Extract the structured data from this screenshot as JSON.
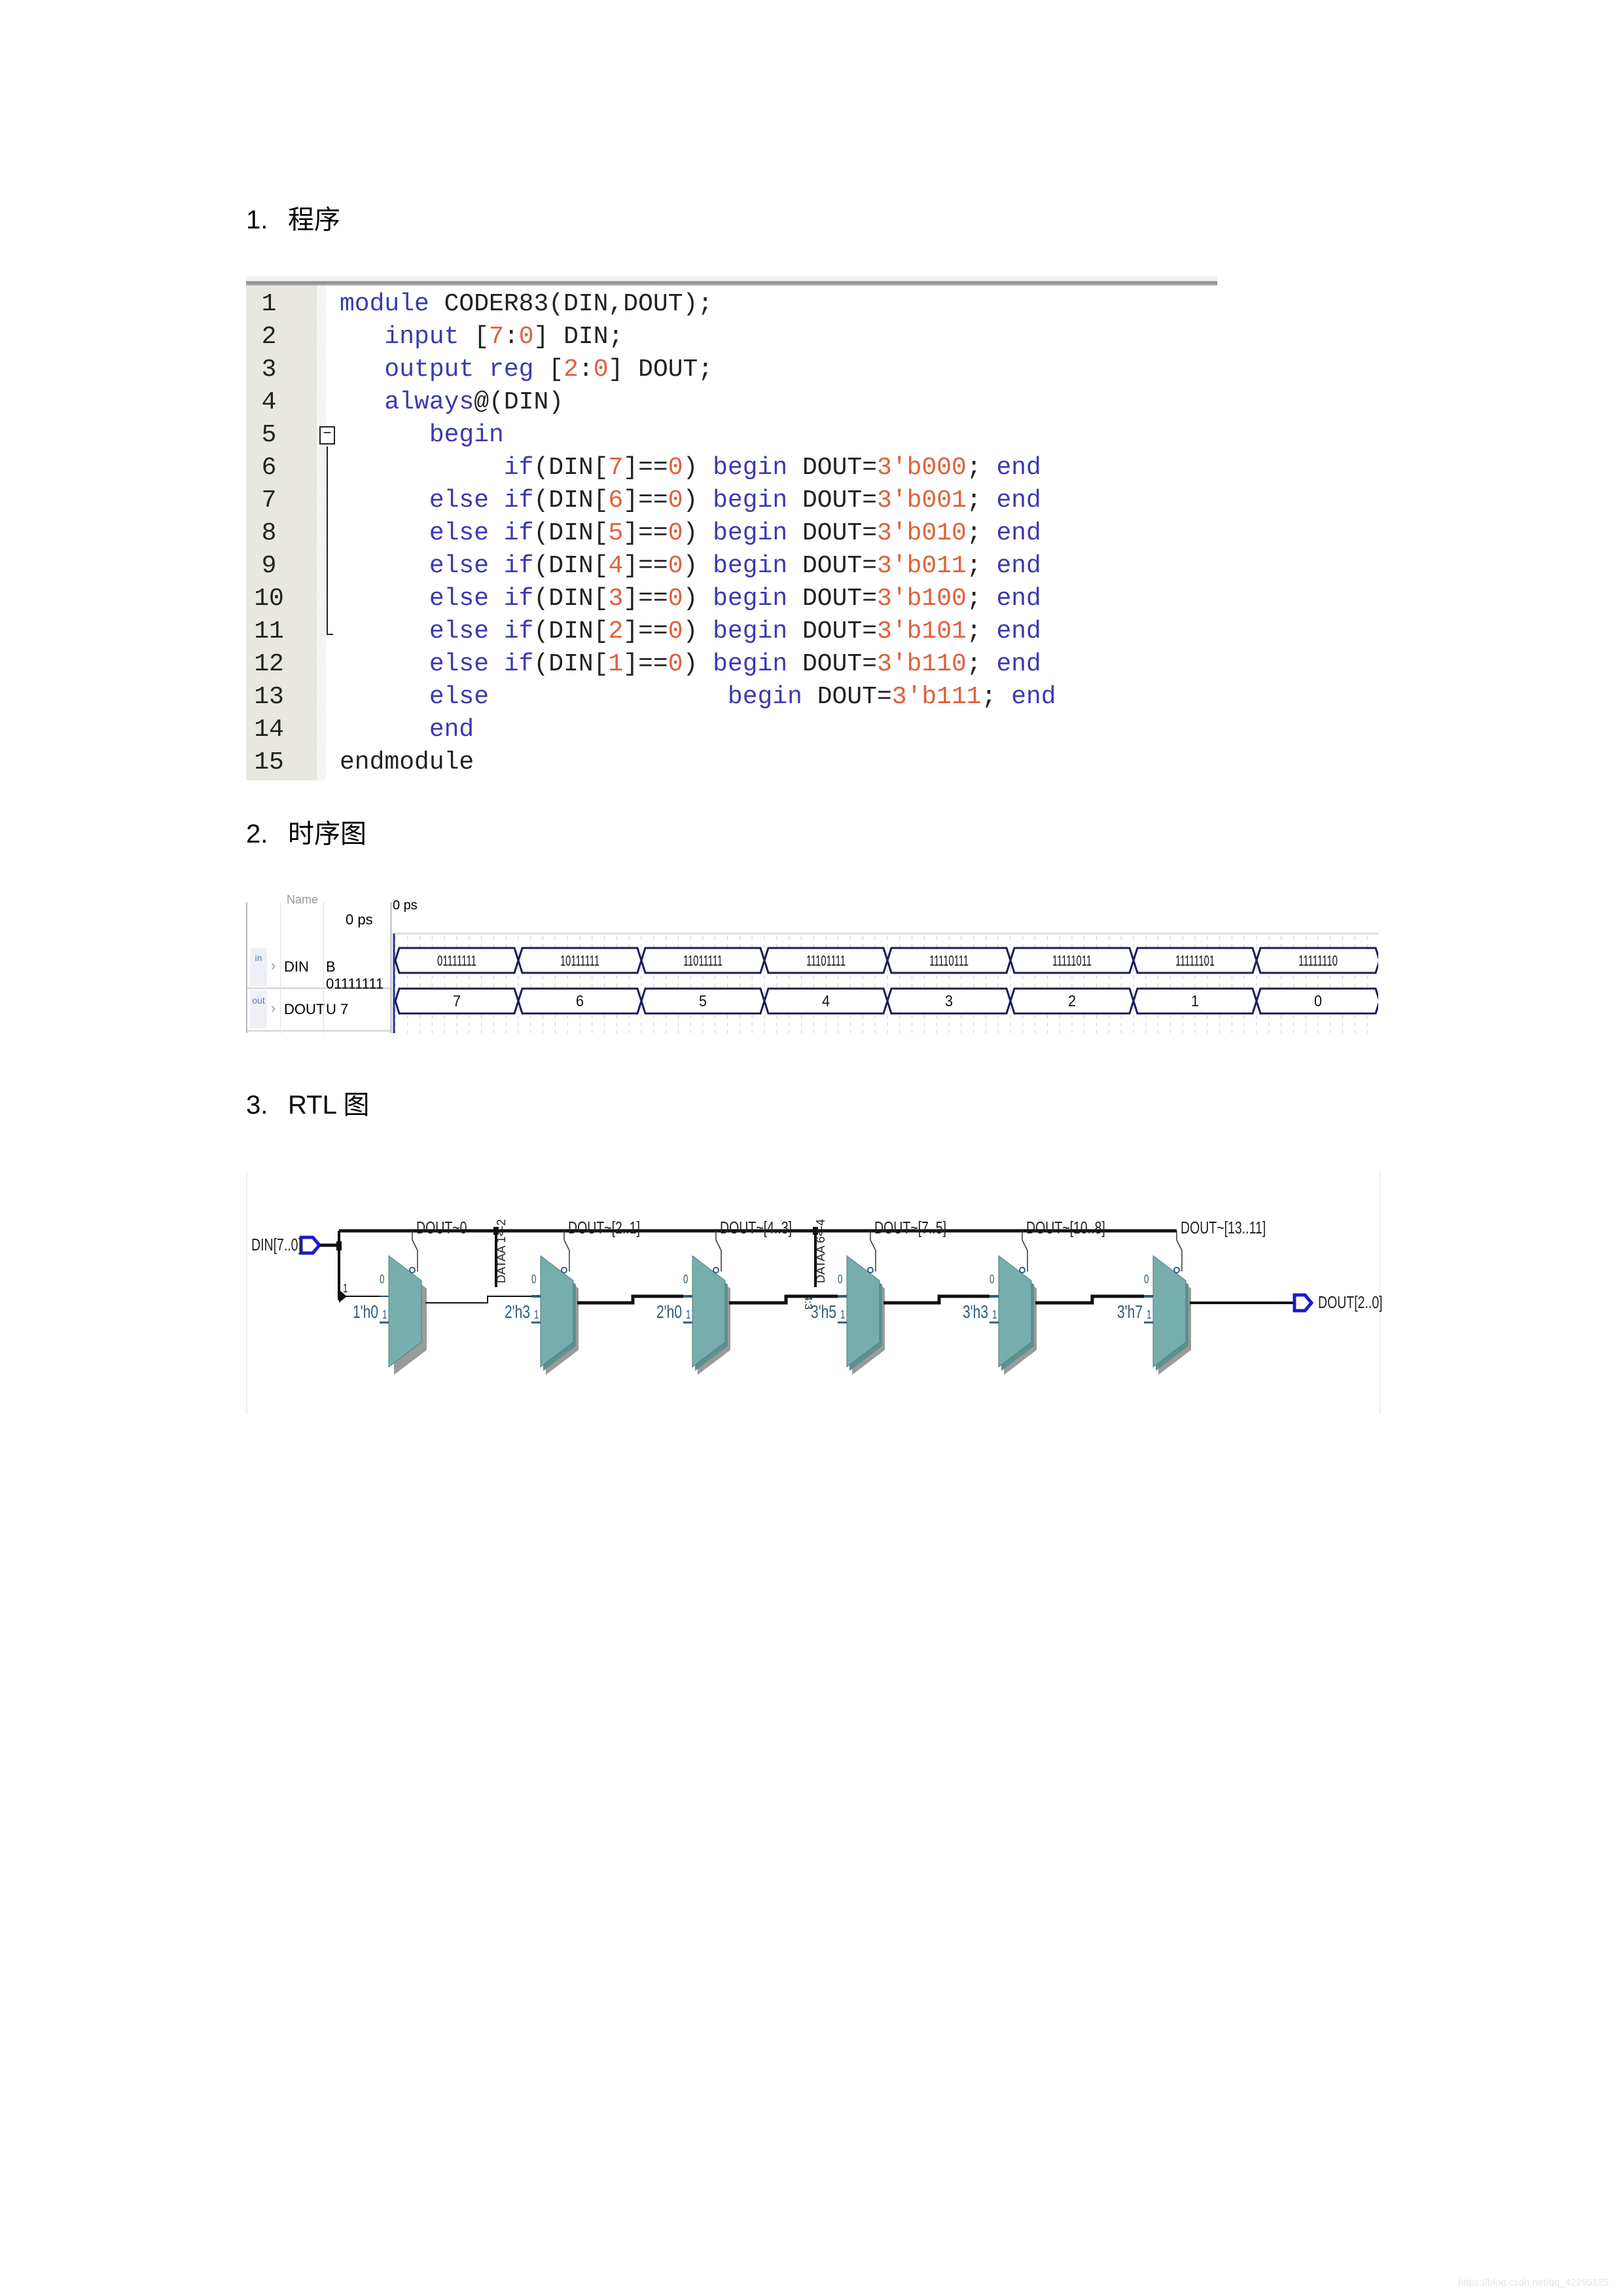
{
  "sections": [
    {
      "number": "1.",
      "title": "程序"
    },
    {
      "number": "2.",
      "title": "时序图"
    },
    {
      "number": "3.",
      "title": "RTL 图"
    }
  ],
  "code": {
    "lines": [
      {
        "n": "1",
        "tokens": [
          [
            "kw",
            "module"
          ],
          [
            "tx",
            " CODER83(DIN,DOUT);"
          ]
        ]
      },
      {
        "n": "2",
        "tokens": [
          [
            "tx",
            "   "
          ],
          [
            "kw",
            "input"
          ],
          [
            "tx",
            " ["
          ],
          [
            "nm",
            "7"
          ],
          [
            "tx",
            ":"
          ],
          [
            "nm",
            "0"
          ],
          [
            "tx",
            "] DIN;"
          ]
        ]
      },
      {
        "n": "3",
        "tokens": [
          [
            "tx",
            "   "
          ],
          [
            "kw",
            "output"
          ],
          [
            "tx",
            " "
          ],
          [
            "kw",
            "reg"
          ],
          [
            "tx",
            " ["
          ],
          [
            "nm",
            "2"
          ],
          [
            "tx",
            ":"
          ],
          [
            "nm",
            "0"
          ],
          [
            "tx",
            "] DOUT;"
          ]
        ]
      },
      {
        "n": "4",
        "tokens": [
          [
            "tx",
            "   "
          ],
          [
            "kw",
            "always"
          ],
          [
            "tx",
            "@(DIN)"
          ]
        ]
      },
      {
        "n": "5",
        "tokens": [
          [
            "tx",
            "      "
          ],
          [
            "kw",
            "begin"
          ]
        ]
      },
      {
        "n": "6",
        "tokens": [
          [
            "tx",
            "           "
          ],
          [
            "kw",
            "if"
          ],
          [
            "tx",
            "(DIN["
          ],
          [
            "nm",
            "7"
          ],
          [
            "tx",
            "]=="
          ],
          [
            "nm",
            "0"
          ],
          [
            "tx",
            ") "
          ],
          [
            "kw",
            "begin"
          ],
          [
            "tx",
            " DOUT="
          ],
          [
            "nm",
            "3'b000"
          ],
          [
            "tx",
            "; "
          ],
          [
            "kw",
            "end"
          ]
        ]
      },
      {
        "n": "7",
        "tokens": [
          [
            "tx",
            "      "
          ],
          [
            "kw",
            "else if"
          ],
          [
            "tx",
            "(DIN["
          ],
          [
            "nm",
            "6"
          ],
          [
            "tx",
            "]=="
          ],
          [
            "nm",
            "0"
          ],
          [
            "tx",
            ") "
          ],
          [
            "kw",
            "begin"
          ],
          [
            "tx",
            " DOUT="
          ],
          [
            "nm",
            "3'b001"
          ],
          [
            "tx",
            "; "
          ],
          [
            "kw",
            "end"
          ]
        ]
      },
      {
        "n": "8",
        "tokens": [
          [
            "tx",
            "      "
          ],
          [
            "kw",
            "else if"
          ],
          [
            "tx",
            "(DIN["
          ],
          [
            "nm",
            "5"
          ],
          [
            "tx",
            "]=="
          ],
          [
            "nm",
            "0"
          ],
          [
            "tx",
            ") "
          ],
          [
            "kw",
            "begin"
          ],
          [
            "tx",
            " DOUT="
          ],
          [
            "nm",
            "3'b010"
          ],
          [
            "tx",
            "; "
          ],
          [
            "kw",
            "end"
          ]
        ]
      },
      {
        "n": "9",
        "tokens": [
          [
            "tx",
            "      "
          ],
          [
            "kw",
            "else if"
          ],
          [
            "tx",
            "(DIN["
          ],
          [
            "nm",
            "4"
          ],
          [
            "tx",
            "]=="
          ],
          [
            "nm",
            "0"
          ],
          [
            "tx",
            ") "
          ],
          [
            "kw",
            "begin"
          ],
          [
            "tx",
            " DOUT="
          ],
          [
            "nm",
            "3'b011"
          ],
          [
            "tx",
            "; "
          ],
          [
            "kw",
            "end"
          ]
        ]
      },
      {
        "n": "10",
        "tokens": [
          [
            "tx",
            "      "
          ],
          [
            "kw",
            "else if"
          ],
          [
            "tx",
            "(DIN["
          ],
          [
            "nm",
            "3"
          ],
          [
            "tx",
            "]=="
          ],
          [
            "nm",
            "0"
          ],
          [
            "tx",
            ") "
          ],
          [
            "kw",
            "begin"
          ],
          [
            "tx",
            " DOUT="
          ],
          [
            "nm",
            "3'b100"
          ],
          [
            "tx",
            "; "
          ],
          [
            "kw",
            "end"
          ]
        ]
      },
      {
        "n": "11",
        "tokens": [
          [
            "tx",
            "      "
          ],
          [
            "kw",
            "else if"
          ],
          [
            "tx",
            "(DIN["
          ],
          [
            "nm",
            "2"
          ],
          [
            "tx",
            "]=="
          ],
          [
            "nm",
            "0"
          ],
          [
            "tx",
            ") "
          ],
          [
            "kw",
            "begin"
          ],
          [
            "tx",
            " DOUT="
          ],
          [
            "nm",
            "3'b101"
          ],
          [
            "tx",
            "; "
          ],
          [
            "kw",
            "end"
          ]
        ]
      },
      {
        "n": "12",
        "tokens": [
          [
            "tx",
            "      "
          ],
          [
            "kw",
            "else if"
          ],
          [
            "tx",
            "(DIN["
          ],
          [
            "nm",
            "1"
          ],
          [
            "tx",
            "]=="
          ],
          [
            "nm",
            "0"
          ],
          [
            "tx",
            ") "
          ],
          [
            "kw",
            "begin"
          ],
          [
            "tx",
            " DOUT="
          ],
          [
            "nm",
            "3'b110"
          ],
          [
            "tx",
            "; "
          ],
          [
            "kw",
            "end"
          ]
        ]
      },
      {
        "n": "13",
        "tokens": [
          [
            "tx",
            "      "
          ],
          [
            "kw",
            "else"
          ],
          [
            "tx",
            "                "
          ],
          [
            "kw",
            "begin"
          ],
          [
            "tx",
            " DOUT="
          ],
          [
            "nm",
            "3'b111"
          ],
          [
            "tx",
            "; "
          ],
          [
            "kw",
            "end"
          ]
        ]
      },
      {
        "n": "14",
        "tokens": [
          [
            "tx",
            "      "
          ],
          [
            "kw",
            "end"
          ]
        ]
      },
      {
        "n": "15",
        "tokens": [
          [
            "tx",
            "endmodule"
          ]
        ]
      }
    ],
    "fold_symbol": "−",
    "colors": {
      "keyword": "#3a3ab0",
      "number": "#e0603a",
      "text": "#222222"
    }
  },
  "waveform": {
    "header_name": "Name",
    "cursor_value_header": "0 ps",
    "timeline_start": "0 ps",
    "signals": [
      {
        "icon": "in",
        "name": "DIN",
        "value": "B 01111111",
        "segments": [
          "01111111",
          "10111111",
          "11011111",
          "11101111",
          "11110111",
          "11111011",
          "11111101",
          "11111110"
        ]
      },
      {
        "icon": "out",
        "name": "DOUT",
        "value": "U 7",
        "segments": [
          "7",
          "6",
          "5",
          "4",
          "3",
          "2",
          "1",
          "0"
        ]
      }
    ],
    "trace_color": "#1c1c5a"
  },
  "rtl": {
    "input_port": "DIN[7..0]",
    "output_port": "DOUT[2..0]",
    "taps": [
      "DATAA 1<-2",
      "DATAA 6<-4"
    ],
    "slice_label": "4:3",
    "muxes": [
      {
        "name": "DOUT~0",
        "const": "1'h0"
      },
      {
        "name": "DOUT~[2..1]",
        "const": "2'h3"
      },
      {
        "name": "DOUT~[4..3]",
        "const": "2'h0"
      },
      {
        "name": "DOUT~[7..5]",
        "const": "3'h5"
      },
      {
        "name": "DOUT~[10..8]",
        "const": "3'h3"
      },
      {
        "name": "DOUT~[13..11]",
        "const": "3'h7"
      }
    ],
    "port_color": "#1a1acc",
    "mux_color": "#76adad"
  },
  "watermark": "https://blog.csdn.net/qq_42295125"
}
